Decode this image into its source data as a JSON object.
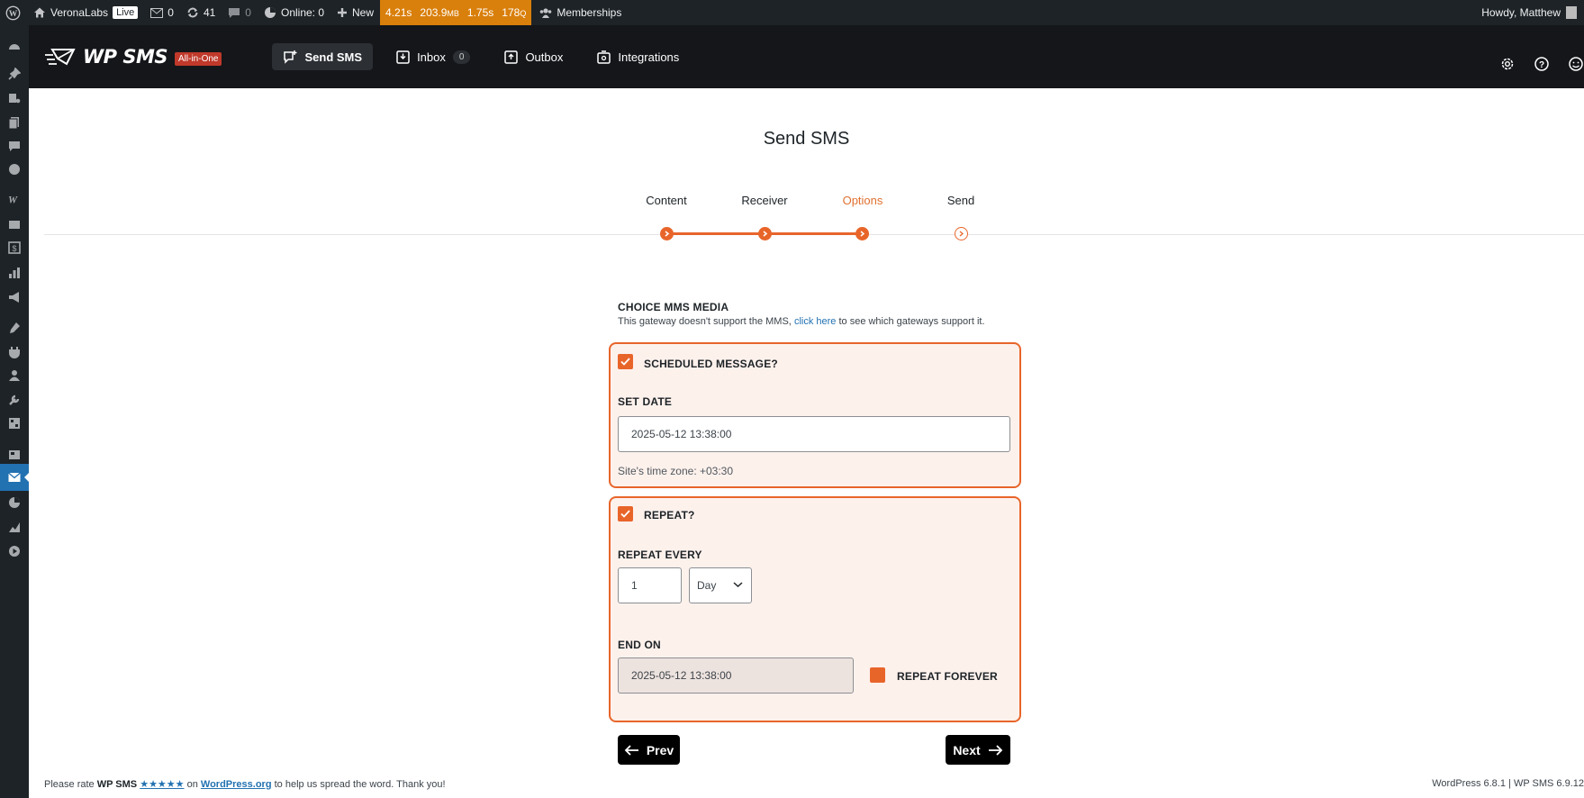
{
  "adminbar": {
    "site_name": "VeronaLabs",
    "live_badge": "Live",
    "messages_count": "0",
    "updates_count": "41",
    "comments_count": "0",
    "online": "Online: 0",
    "new_label": "New",
    "perf": {
      "time": "4.21s",
      "memory": "203.9",
      "memory_unit": "MB",
      "query_time": "1.75s",
      "queries": "178",
      "queries_unit": "Q"
    },
    "memberships": "Memberships",
    "howdy": "Howdy, Matthew"
  },
  "header": {
    "brand": "WP SMS",
    "badge": "All-in-One",
    "nav": [
      {
        "label": "Send SMS"
      },
      {
        "label": "Inbox",
        "count": "0"
      },
      {
        "label": "Outbox"
      },
      {
        "label": "Integrations"
      }
    ]
  },
  "page": {
    "title": "Send SMS"
  },
  "steps": [
    {
      "label": "Content"
    },
    {
      "label": "Receiver"
    },
    {
      "label": "Options"
    },
    {
      "label": "Send"
    }
  ],
  "mms": {
    "heading": "CHOICE MMS MEDIA",
    "text_before": "This gateway doesn't support the MMS,",
    "link": "click here",
    "text_after": "to see which gateways support it."
  },
  "schedule": {
    "checkbox_label": "SCHEDULED MESSAGE?",
    "checked": true,
    "set_date_label": "SET DATE",
    "date_value": "2025-05-12 13:38:00",
    "timezone": "Site's time zone: +03:30"
  },
  "repeat": {
    "checkbox_label": "REPEAT?",
    "checked": true,
    "every_label": "REPEAT EVERY",
    "every_value": "1",
    "unit_value": "Day",
    "end_label": "END ON",
    "end_value": "2025-05-12 13:38:00",
    "forever_label": "REPEAT FOREVER",
    "forever_checked": false
  },
  "buttons": {
    "prev": "Prev",
    "next": "Next"
  },
  "footer": {
    "text1": "Please rate",
    "plugin": "WP SMS",
    "stars": "★★★★★",
    "text2": "on",
    "link": "WordPress.org",
    "text3": "to help us spread the word. Thank you!",
    "version": "WordPress 6.8.1 | WP SMS 6.9.12"
  },
  "colors": {
    "accent": "#e8652a",
    "card_bg": "#fdf1ec",
    "admin_bar": "#1d2327",
    "header_bg": "#14161a",
    "perf_bg": "#d97f0b",
    "sidebar_active": "#2271b1"
  }
}
